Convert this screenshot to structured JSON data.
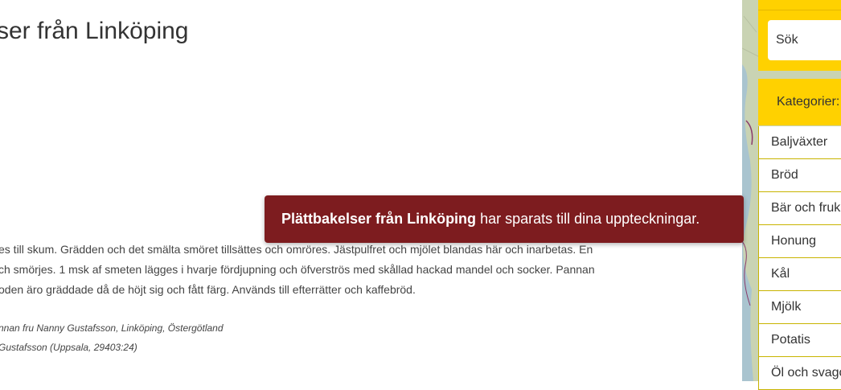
{
  "page": {
    "title": "ser från Linköping",
    "paragraph_lines": [
      "es till skum. Grädden och det smälta smöret tillsättes och omröres. Jästpulfret och mjölet blandas här och inarbetas. En",
      "ch smörjes. 1 msk af smeten lägges i hvarje fördjupning och öfverströs med skållad hackad mandel och socker. Pannan",
      "oden äro gräddade då de höjt sig och fått färg. Används till efterrätter och kaffebröd."
    ],
    "meta_lines": [
      "nnan fru Nanny Gustafsson, Linköping, Östergötland",
      "Gustafsson (Uppsala, 29403:24)"
    ]
  },
  "toast": {
    "recipe_name": "Plättbakelser från Linköping",
    "message": " har sparats till dina uppteckningar."
  },
  "sidebar": {
    "search_placeholder": "Sök",
    "categories_header": "Kategorier:",
    "categories": [
      "Baljväxter",
      "Bröd",
      "Bär och fruk",
      "Honung",
      "Kål",
      "Mjölk",
      "Potatis",
      "Öl och svago"
    ]
  },
  "colors": {
    "accent_yellow": "#ffd100",
    "toast_bg": "#7d1c1f"
  }
}
